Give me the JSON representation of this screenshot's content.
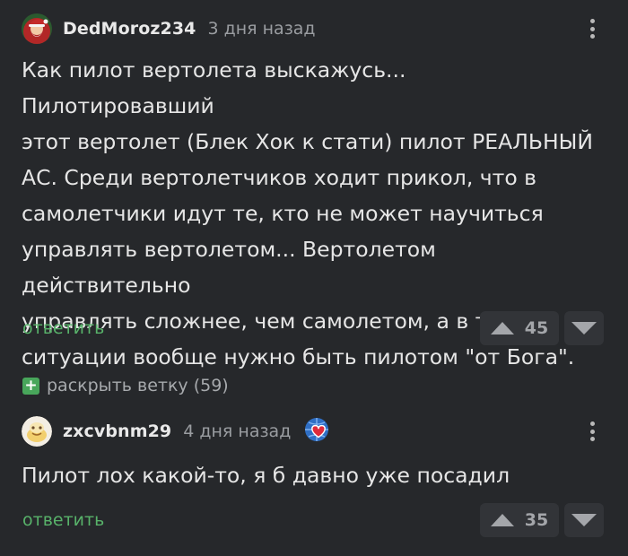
{
  "comments": [
    {
      "username": "DedMoroz234",
      "time": "3 дня назад",
      "text": [
        "Как пилот вертолета выскажусь... Пилотировавший",
        "этот вертолет (Блек Хок к стати) пилот РЕАЛЬНЫЙ",
        "АС. Среди вертолетчиков ходит прикол, что в",
        "самолетчики идут те, кто не может научиться",
        "управлять вертолетом... Вертолетом действительно",
        "управлять сложнее, чем самолетом, а в такой",
        "ситуации вообще нужно быть пилотом \"от Бога\"."
      ],
      "reply_label": "ответить",
      "score": "45"
    },
    {
      "username": "zxcvbnm29",
      "time": "4 дня назад",
      "text": [
        "Пилот лох какой-то, я б давно уже посадил"
      ],
      "reply_label": "ответить",
      "score": "35"
    }
  ],
  "thread": {
    "expand_label": "раскрыть ветку (59)",
    "expand_icon": "+"
  },
  "colors": {
    "background": "#26282b",
    "accent": "#58b26a",
    "button_bg": "#323438"
  }
}
